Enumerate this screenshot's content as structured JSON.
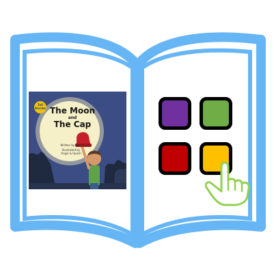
{
  "cover": {
    "badge_line1": "Tell",
    "badge_line2": "Stories",
    "title_line1": "The Moon",
    "title_and": "and",
    "title_line2": "The Cap",
    "written_by": "Written by Noni",
    "illustrated_by_line1": "Illustrated by",
    "illustrated_by_line2": "Angie & Upesh"
  },
  "colors": {
    "book_outline": "#66b5f5",
    "tile_purple": "#7030a0",
    "tile_green": "#70ad47",
    "tile_red": "#c00000",
    "tile_yellow": "#ffc000",
    "hand_outline": "#92d050",
    "cover_sky": "#3c4c84",
    "cover_moon": "#f6f0c8"
  },
  "icons": {
    "book": "open-book-icon",
    "pointer": "pointing-hand-icon"
  }
}
